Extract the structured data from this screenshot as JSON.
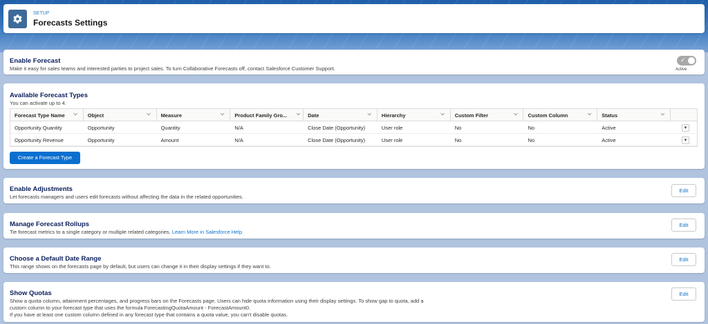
{
  "header": {
    "breadcrumb": "SETUP",
    "title": "Forecasts Settings",
    "icon": "gear-icon",
    "icon_bg": "#3d6a9a"
  },
  "enable_forecast": {
    "title": "Enable Forecast",
    "description": "Make it easy for sales teams and interested parties to project sales. To turn Collaborative Forecasts off, contact Salesforce Customer Support.",
    "toggle_state": "Active"
  },
  "forecast_types": {
    "title": "Available Forecast Types",
    "subtitle": "You can activate up to 4.",
    "columns": [
      "Forecast Type Name",
      "Object",
      "Measure",
      "Product Family Gro...",
      "Date",
      "Hierarchy",
      "Custom Filter",
      "Custom Column",
      "Status"
    ],
    "rows": [
      [
        "Opportunity Quantity",
        "Opportunity",
        "Quantity",
        "N/A",
        "Close Date (Opportunity)",
        "User role",
        "No",
        "No",
        "Active"
      ],
      [
        "Opportunity Revenue",
        "Opportunity",
        "Amount",
        "N/A",
        "Close Date (Opportunity)",
        "User role",
        "No",
        "No",
        "Active"
      ]
    ],
    "create_button": "Create a Forecast Type"
  },
  "enable_adjustments": {
    "title": "Enable Adjustments",
    "description": "Let forecasts managers and users edit forecasts without affecting the data in the related opportunities.",
    "edit_label": "Edit"
  },
  "rollups": {
    "title": "Manage Forecast Rollups",
    "description": "Tie forecast metrics to a single category or multiple related categories.",
    "link": "Learn More in Salesforce Help",
    "edit_label": "Edit"
  },
  "date_range": {
    "title": "Choose a Default Date Range",
    "description": "This range shows on the forecasts page by default, but users can change it in their display settings if they want to.",
    "edit_label": "Edit"
  },
  "quotas": {
    "title": "Show Quotas",
    "line1": "Show a quota column, attainment percentages, and progress bars on the Forecasts page. Users can hide quota information using their display settings. To show gap to quota, add a",
    "line2": "custom column to your forecast type that uses the formula ForecastingQuotaAmount - ForecastAmount0.",
    "line3": "If you have at least one custom column defined in any forecast type that contains a quota value, you can't disable quotas.",
    "edit_label": "Edit"
  },
  "colors": {
    "primary": "#0b6fd0",
    "title": "#0b1f5c",
    "link": "#0b6fcc"
  }
}
